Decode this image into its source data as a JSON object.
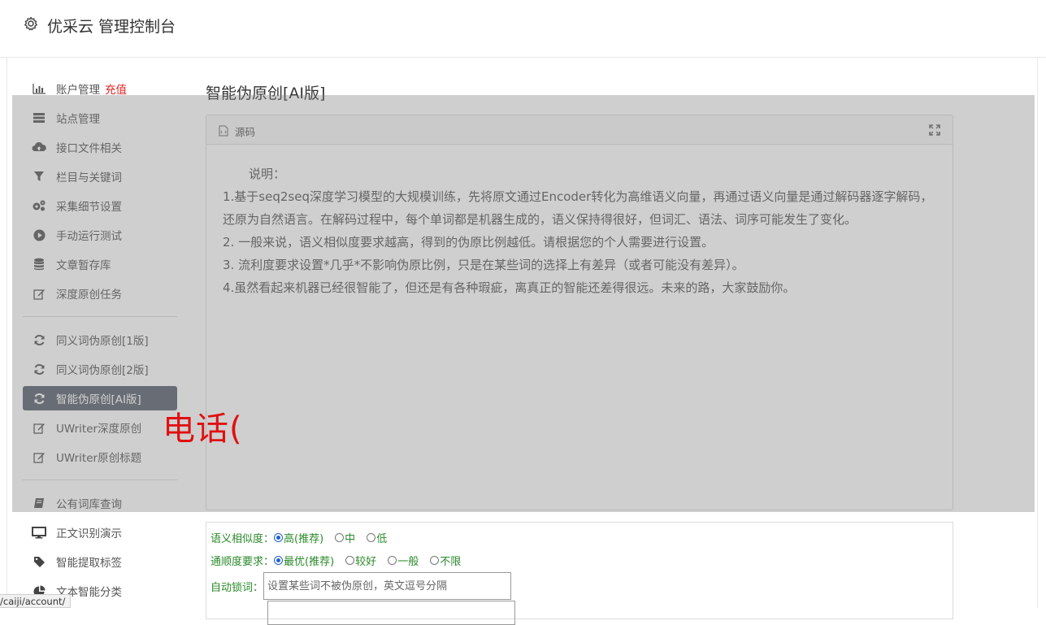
{
  "header": {
    "title": "优采云 管理控制台",
    "icon": "gear-icon"
  },
  "sidebar": {
    "items": [
      {
        "label": "账户管理",
        "badge": "充值",
        "icon": "bar-chart-icon"
      },
      {
        "label": "站点管理",
        "icon": "server-icon"
      },
      {
        "label": "接口文件相关",
        "icon": "cloud-upload-icon"
      },
      {
        "label": "栏目与关键词",
        "icon": "filter-icon"
      },
      {
        "label": "采集细节设置",
        "icon": "cogs-icon"
      },
      {
        "label": "手动运行测试",
        "icon": "play-circle-icon"
      },
      {
        "label": "文章暂存库",
        "icon": "database-icon"
      },
      {
        "label": "深度原创任务",
        "icon": "edit-icon"
      },
      {
        "label": "同义词伪原创[1版]",
        "icon": "refresh-icon"
      },
      {
        "label": "同义词伪原创[2版]",
        "icon": "refresh-icon"
      },
      {
        "label": "智能伪原创[AI版]",
        "icon": "refresh-icon",
        "active": true
      },
      {
        "label": "UWriter深度原创",
        "icon": "edit-icon"
      },
      {
        "label": "UWriter原创标题",
        "icon": "edit-icon"
      },
      {
        "label": "公有词库查询",
        "icon": "book-icon"
      },
      {
        "label": "正文识别演示",
        "icon": "monitor-icon"
      },
      {
        "label": "智能提取标签",
        "icon": "tag-icon"
      },
      {
        "label": "文本智能分类",
        "icon": "pie-chart-icon"
      }
    ]
  },
  "main": {
    "title": "智能伪原创[AI版]",
    "panel": {
      "title": "源码",
      "note_title": "说明：",
      "notes": [
        "1.基于seq2seq深度学习模型的大规模训练，先将原文通过Encoder转化为高维语义向量，再通过语义向量是通过解码器逐字解码，还原为自然语言。在解码过程中，每个单词都是机器生成的，语义保持得很好，但词汇、语法、词序可能发生了变化。",
        "2. 一般来说，语义相似度要求越高，得到的伪原比例越低。请根据您的个人需要进行设置。",
        "3. 流利度要求设置*几乎*不影响伪原比例，只是在某些词的选择上有差异（或者可能没有差异）。",
        "4.虽然看起来机器已经很智能了，但还是有各种瑕疵，离真正的智能还差得很远。未来的路，大家鼓励你。"
      ]
    },
    "overlay_text": "电话(",
    "form": {
      "similarity": {
        "label": "语义相似度：",
        "options": [
          "高(推荐)",
          "中",
          "低"
        ],
        "selected": 0
      },
      "fluency": {
        "label": "通顺度要求：",
        "options": [
          "最优(推荐)",
          "较好",
          "一般",
          "不限"
        ],
        "selected": 0
      },
      "lock": {
        "label": "自动锁词：",
        "placeholder": "设置某些词不被伪原创，英文逗号分隔"
      }
    }
  },
  "status_bar": {
    "url": "/caiji/account/"
  },
  "colors": {
    "active_nav_bg": "#59616e",
    "recharge": "#e02020",
    "form_label": "#2a8a2a",
    "phone_text": "#e01010"
  }
}
